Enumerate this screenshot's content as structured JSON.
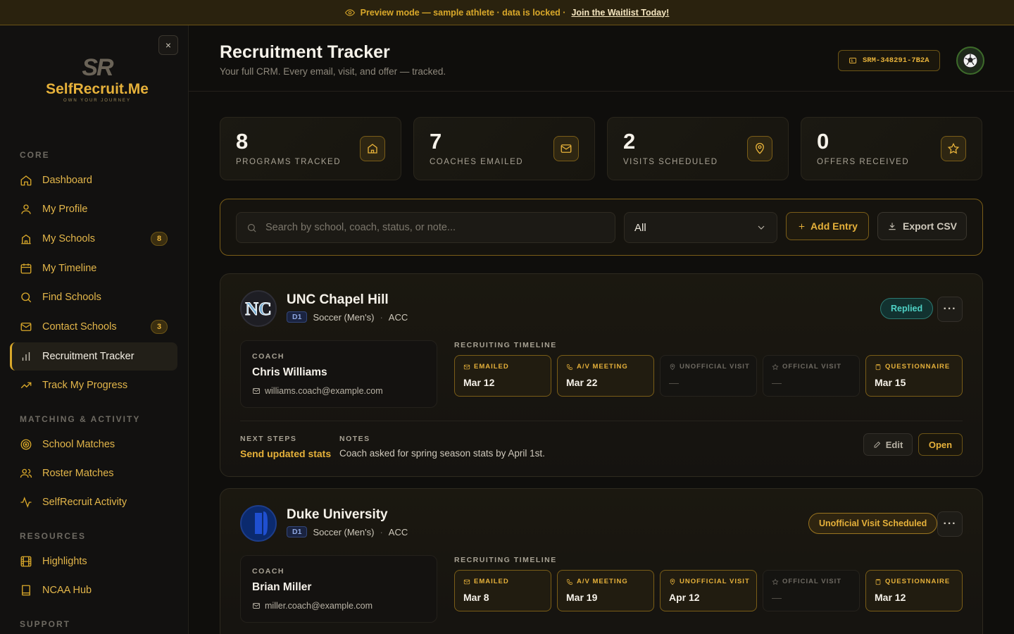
{
  "banner": {
    "text": "Preview mode — sample athlete · data is locked · ",
    "link": "Join the Waitlist Today!"
  },
  "sidebar": {
    "close": "×",
    "logo_mark": "SR",
    "logo_name": "SelfRecruit.Me",
    "logo_tagline": "OWN YOUR JOURNEY",
    "sections": [
      "CORE",
      "MATCHING & ACTIVITY",
      "RESOURCES",
      "SUPPORT"
    ],
    "items": [
      {
        "label": "Dashboard",
        "icon": "home-icon"
      },
      {
        "label": "My Profile",
        "icon": "user-icon"
      },
      {
        "label": "My Schools",
        "icon": "school-icon",
        "badge": "8"
      },
      {
        "label": "My Timeline",
        "icon": "calendar-icon"
      },
      {
        "label": "Find Schools",
        "icon": "search-icon"
      },
      {
        "label": "Contact Schools",
        "icon": "mail-icon",
        "badge": "3"
      },
      {
        "label": "Recruitment Tracker",
        "icon": "bar-chart-icon",
        "active": true
      },
      {
        "label": "Track My Progress",
        "icon": "trend-icon"
      },
      {
        "label": "School Matches",
        "icon": "target-icon"
      },
      {
        "label": "Roster Matches",
        "icon": "users-icon"
      },
      {
        "label": "SelfRecruit Activity",
        "icon": "activity-icon"
      },
      {
        "label": "Highlights",
        "icon": "film-icon"
      },
      {
        "label": "NCAA Hub",
        "icon": "book-icon"
      }
    ]
  },
  "header": {
    "title": "Recruitment Tracker",
    "subtitle": "Your full CRM. Every email, visit, and offer — tracked.",
    "athlete_id": "SRM-348291-7B2A"
  },
  "stats": [
    {
      "value": "8",
      "label": "PROGRAMS TRACKED",
      "icon": "school-icon"
    },
    {
      "value": "7",
      "label": "COACHES EMAILED",
      "icon": "mail-icon"
    },
    {
      "value": "2",
      "label": "VISITS SCHEDULED",
      "icon": "map-pin-icon"
    },
    {
      "value": "0",
      "label": "OFFERS RECEIVED",
      "icon": "star-icon"
    }
  ],
  "filters": {
    "search_placeholder": "Search by school, coach, status, or note...",
    "status_value": "All",
    "add_label": "Add Entry",
    "export_label": "Export CSV"
  },
  "labels": {
    "coach": "COACH",
    "timeline": "RECRUITING TIMELINE",
    "next_steps": "NEXT STEPS",
    "notes": "NOTES",
    "edit": "Edit",
    "open": "Open",
    "more": "···"
  },
  "schools": [
    {
      "name": "UNC Chapel Hill",
      "division": "D1",
      "sport": "Soccer (Men's)",
      "conference": "ACC",
      "status": "Replied",
      "coach_name": "Chris Williams",
      "coach_email": "williams.coach@example.com",
      "timeline": [
        {
          "name": "EMAILED",
          "date": "Mar 12",
          "done": true,
          "icon": "mail-icon"
        },
        {
          "name": "A/V MEETING",
          "date": "Mar 22",
          "done": true,
          "icon": "phone-icon"
        },
        {
          "name": "UNOFFICIAL VISIT",
          "date": "—",
          "done": false,
          "icon": "map-pin-icon"
        },
        {
          "name": "OFFICIAL VISIT",
          "date": "—",
          "done": false,
          "icon": "star-icon"
        },
        {
          "name": "QUESTIONNAIRE",
          "date": "Mar 15",
          "done": true,
          "icon": "clipboard-icon"
        }
      ],
      "next_steps": "Send updated stats",
      "notes": "Coach asked for spring season stats by April 1st."
    },
    {
      "name": "Duke University",
      "division": "D1",
      "sport": "Soccer (Men's)",
      "conference": "ACC",
      "status": "Unofficial Visit Scheduled",
      "coach_name": "Brian Miller",
      "coach_email": "miller.coach@example.com",
      "timeline": [
        {
          "name": "EMAILED",
          "date": "Mar 8",
          "done": true,
          "icon": "mail-icon"
        },
        {
          "name": "A/V MEETING",
          "date": "Mar 19",
          "done": true,
          "icon": "phone-icon"
        },
        {
          "name": "UNOFFICIAL VISIT",
          "date": "Apr 12",
          "done": true,
          "icon": "map-pin-icon"
        },
        {
          "name": "OFFICIAL VISIT",
          "date": "—",
          "done": false,
          "icon": "star-icon"
        },
        {
          "name": "QUESTIONNAIRE",
          "date": "Mar 12",
          "done": true,
          "icon": "clipboard-icon"
        }
      ]
    }
  ],
  "colors": {
    "accent": "#e6b13a",
    "replied": "#4fd1c5",
    "unofficial": "#e6b13a"
  }
}
